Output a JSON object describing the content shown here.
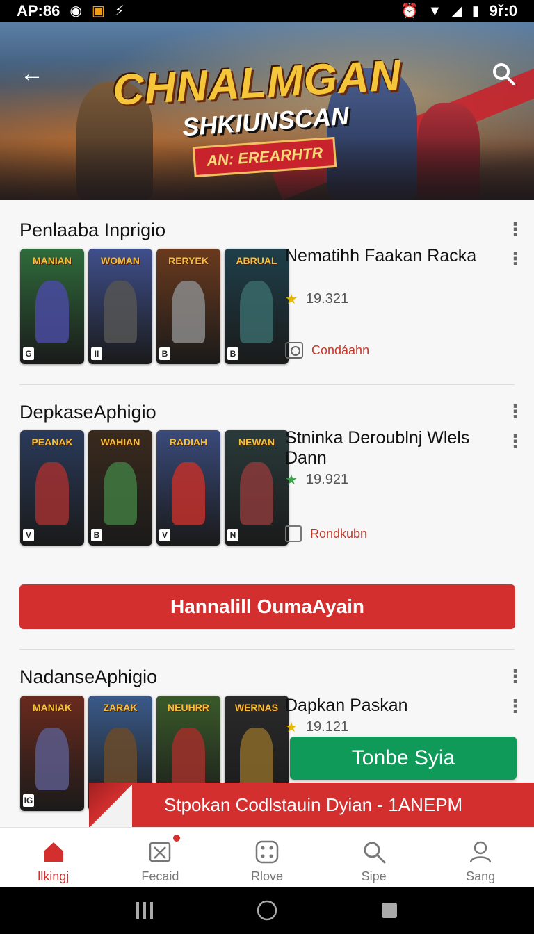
{
  "status_bar": {
    "time": "AP:86",
    "clock": "9ř:0"
  },
  "banner": {
    "title": "CHNALMGAN",
    "subtitle": "SHKIUNSCAN",
    "tag": "AN: EREARHTR"
  },
  "sections": [
    {
      "title": "Penlaaba Inprigio",
      "game_name": "Nematihh Faakan Racka",
      "rating": "19.321",
      "star_color": "#e3b400",
      "action_label": "Condáahn",
      "action_icon": "camera-icon",
      "thumbs": [
        {
          "head": "MANIAN",
          "badge": "G",
          "bg": "#2f6b3b",
          "fig": "#4a4aa0"
        },
        {
          "head": "WOMAN",
          "badge": "II",
          "bg": "#3f4f8c",
          "fig": "#555"
        },
        {
          "head": "RERYEK",
          "badge": "B",
          "bg": "#6a3a1e",
          "fig": "#8a8a8a"
        },
        {
          "head": "ABRUAL",
          "badge": "B",
          "bg": "#1f3f4a",
          "fig": "#3a6a6a"
        }
      ]
    },
    {
      "title": "DepkaseAphigio",
      "game_name": "Stninka Deroublnj Wlels Dann",
      "rating": "19.921",
      "star_color": "#3aa04a",
      "action_label": "Rondkubn",
      "action_icon": "checkbox-icon",
      "thumbs": [
        {
          "head": "PEANAK",
          "badge": "V",
          "bg": "#2a3a5a",
          "fig": "#a03030"
        },
        {
          "head": "WAHIAN",
          "badge": "B",
          "bg": "#3a2a1e",
          "fig": "#3f7a3f"
        },
        {
          "head": "RADIAH",
          "badge": "V",
          "bg": "#3a4a7a",
          "fig": "#c0302a"
        },
        {
          "head": "NEWAN",
          "badge": "N",
          "bg": "#2a3a3a",
          "fig": "#8a3a3a"
        }
      ]
    },
    {
      "title": "NadanseAphigio",
      "game_name": "Dapkan Paskan",
      "rating": "19.121",
      "star_color": "#e3b400",
      "thumbs": [
        {
          "head": "MANIAK",
          "badge": "IG",
          "bg": "#6a2a1e",
          "fig": "#5a5a8a"
        },
        {
          "head": "ZARAK",
          "badge": "",
          "bg": "#3a5a8a",
          "fig": "#6a4a2a"
        },
        {
          "head": "NEUHRR",
          "badge": "",
          "bg": "#3a5a2a",
          "fig": "#a0302a"
        },
        {
          "head": "WERNAS",
          "badge": "",
          "bg": "#2a2a2a",
          "fig": "#8a6a2a"
        }
      ]
    }
  ],
  "cta_button": "Hannalill OumaAyain",
  "green_button": "Tonbe Syia",
  "promo_banner": "Stpokan Codlstauin Dyian - 1ANEPM",
  "bottom_nav": [
    {
      "label": "llkingj",
      "icon": "home-icon",
      "active": true
    },
    {
      "label": "Fecaid",
      "icon": "featured-icon",
      "active": false
    },
    {
      "label": "Rlove",
      "icon": "grid-icon",
      "active": false
    },
    {
      "label": "Sipe",
      "icon": "search-icon",
      "active": false
    },
    {
      "label": "Sang",
      "icon": "profile-icon",
      "active": false
    }
  ],
  "colors": {
    "accent": "#d32f2f",
    "green": "#0f9a5a",
    "background": "#f7f7f7"
  }
}
